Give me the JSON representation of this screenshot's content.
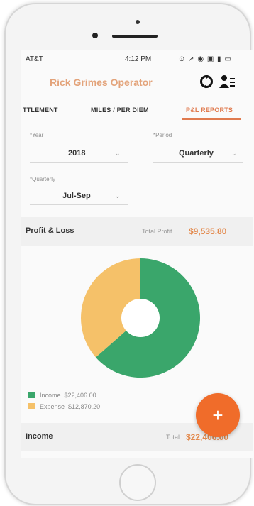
{
  "status_bar": {
    "carrier": "AT&T",
    "time": "4:12 PM",
    "right_icons": "⊙ ↗ ◉ ▣ ▮ ▭"
  },
  "header": {
    "title": "Rick Grimes Operator"
  },
  "tabs": [
    {
      "label": "TTLEMENT",
      "active": false
    },
    {
      "label": "MILES / PER DIEM",
      "active": false
    },
    {
      "label": "P&L REPORTS",
      "active": true
    }
  ],
  "filters": {
    "year": {
      "label": "*Year",
      "value": "2018"
    },
    "period": {
      "label": "*Period",
      "value": "Quarterly"
    },
    "quarterly": {
      "label": "*Quarterly",
      "value": "Jul-Sep"
    }
  },
  "profit_loss": {
    "title": "Profit & Loss",
    "total_label": "Total Profit",
    "total_value": "$9,535.80"
  },
  "legend": [
    {
      "label": "Income",
      "value": "$22,406.00",
      "color": "#3aa66b"
    },
    {
      "label": "Expense",
      "value": "$12,870.20",
      "color": "#f5c169"
    }
  ],
  "chart_data": {
    "type": "pie",
    "categories": [
      "Income",
      "Expense"
    ],
    "values": [
      22406.0,
      12870.2
    ],
    "colors": [
      "#3aa66b",
      "#f5c169"
    ]
  },
  "income_section": {
    "title": "Income",
    "total_label": "Total",
    "total_value": "$22,406.00"
  },
  "fab": {
    "label": "+"
  },
  "colors": {
    "accent": "#e07a4e",
    "fab": "#f06c2a"
  }
}
